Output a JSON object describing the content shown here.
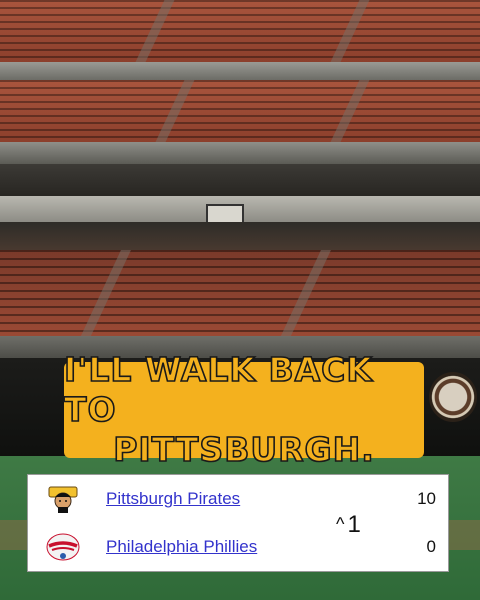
{
  "caption": {
    "line1": "I'll walk back to",
    "line2": "Pittsburgh."
  },
  "scorecard": {
    "teams": [
      {
        "name": "Pittsburgh Pirates",
        "score": "10",
        "logo_icon": "pirates-logo"
      },
      {
        "name": "Philadelphia Phillies",
        "score": "0",
        "logo_icon": "phillies-logo"
      }
    ],
    "indicator": {
      "caret": "^",
      "value": "1"
    }
  },
  "colors": {
    "caption_bg": "#f4b11e",
    "caption_text_outline": "#1a1a1a",
    "link": "#3333cc",
    "card_bg": "#ffffff"
  }
}
